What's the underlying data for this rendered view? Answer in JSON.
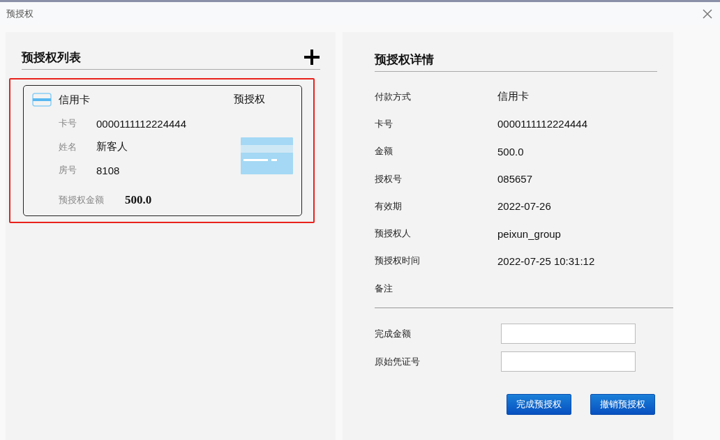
{
  "window": {
    "title": "预授权"
  },
  "list": {
    "title": "预授权列表",
    "cards": [
      {
        "selected": true,
        "type": "信用卡",
        "badge": "预授权",
        "fields": [
          {
            "label": "卡号",
            "value": "0000111112224444"
          },
          {
            "label": "姓名",
            "value": "新客人"
          },
          {
            "label": "房号",
            "value": "8108"
          }
        ],
        "amount_label": "预授权金额",
        "amount": "500.0"
      }
    ]
  },
  "details": {
    "title": "预授权详情",
    "rows": [
      {
        "label": "付款方式",
        "value": "信用卡"
      },
      {
        "label": "卡号",
        "value": "0000111112224444"
      },
      {
        "label": "金额",
        "value": "500.0"
      },
      {
        "label": "授权号",
        "value": "085657"
      },
      {
        "label": "有效期",
        "value": "2022-07-26"
      },
      {
        "label": "预授权人",
        "value": "peixun_group"
      },
      {
        "label": "预授权时间",
        "value": "2022-07-25 10:31:12"
      },
      {
        "label": "备注"
      }
    ],
    "inputs": [
      {
        "label": "完成金额"
      },
      {
        "label": "原始凭证号"
      }
    ],
    "buttons": [
      "完成预授权",
      "撤销预授权"
    ]
  }
}
